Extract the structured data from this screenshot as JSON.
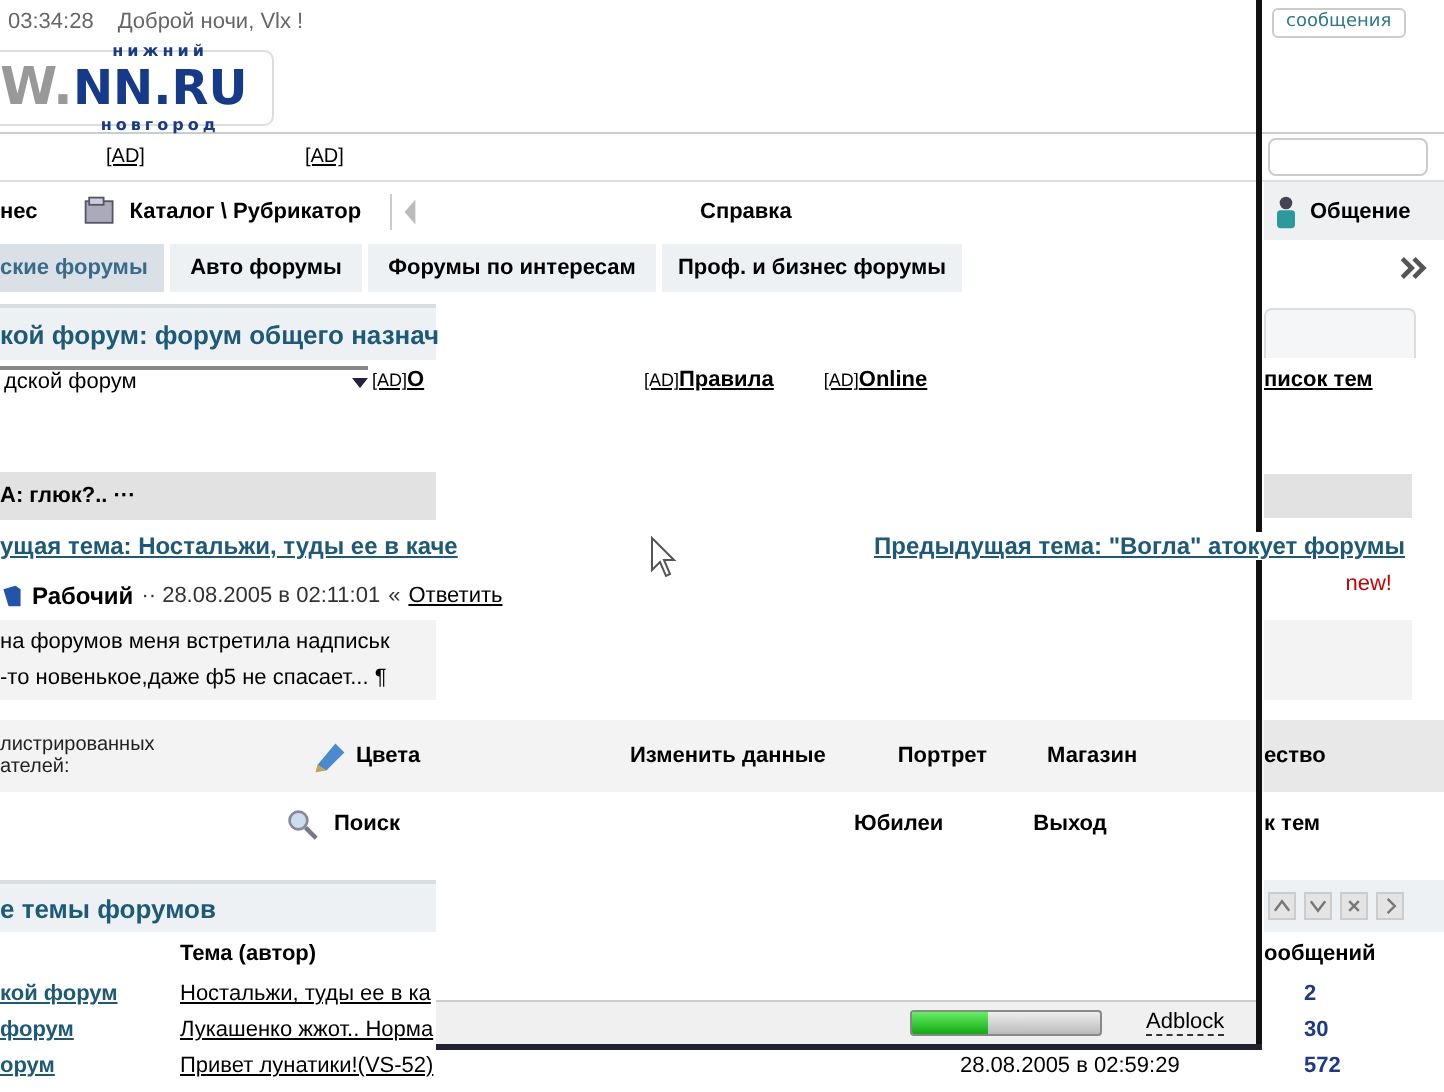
{
  "top_bar": {
    "time": "03:34:28",
    "greeting": "Доброй ночи, Vlx !",
    "messages_button": "сообщения"
  },
  "logo": {
    "prefix": "W.",
    "name": "NN.RU",
    "top": "нижний",
    "bottom": "новгород"
  },
  "ad_links": [
    "[AD]",
    "[AD]"
  ],
  "nav": {
    "left_cut": "нес",
    "catalog": "Каталог \\ Рубрикатор",
    "help": "Справка",
    "chat": "Общение"
  },
  "tabs": [
    {
      "label": "ские форумы",
      "selected": true
    },
    {
      "label": "Авто форумы",
      "selected": false
    },
    {
      "label": "Форумы по интересам",
      "selected": false
    },
    {
      "label": "Проф. и бизнес форумы",
      "selected": false
    }
  ],
  "forum": {
    "title": "кой форум: форум общего назнач",
    "select_value": "дской форум",
    "links": [
      {
        "prefix": "[AD]",
        "label": "О"
      },
      {
        "prefix": "[AD]",
        "label": "Правила"
      },
      {
        "prefix": "[AD]",
        "label": "Online"
      }
    ],
    "topic_list": "писок тем"
  },
  "thread": {
    "title": "А: глюк?.. ···",
    "next_link": "ущая тема: Ностальжи, туды ее в каче",
    "prev_link": "Предыдущая тема: \"Вогла\" атокует форумы"
  },
  "post": {
    "author": "Рабочий",
    "meta": "·· 28.08.2005 в 02:11:01",
    "reply_prefix": "«",
    "reply": "Ответить",
    "new_badge": "new!",
    "lines": [
      "на форумов меня встретила надписьк",
      "-то новенькое,даже ф5 не спасает... ¶"
    ]
  },
  "user_panel": {
    "note_lines": [
      "листрированных",
      "ателей:"
    ],
    "colors": "Цвета",
    "edit": "Изменить данные",
    "portrait": "Портрет",
    "shop": "Магазин",
    "right_cut": "ество",
    "search": "Поиск",
    "jubilee": "Юбилеи",
    "exit": "Выход",
    "right_cut_2": "к тем"
  },
  "latest": {
    "title": "е темы форумов",
    "columns": [
      "Тема (автор)",
      "ообщений"
    ],
    "rows": [
      {
        "forum": "кой форум",
        "topic": "Ностальжи, туды ее в ка",
        "count": "2"
      },
      {
        "forum": "форум",
        "topic": "Лукашенко жжот.. Норма",
        "count": "30"
      },
      {
        "forum": "орум",
        "topic": "Привет лунатики!(VS-52)",
        "date": "28.08.2005 в 02:59:29",
        "count": "572"
      }
    ]
  },
  "status_bar": {
    "level": 0.4,
    "adblock": "Adblock"
  }
}
